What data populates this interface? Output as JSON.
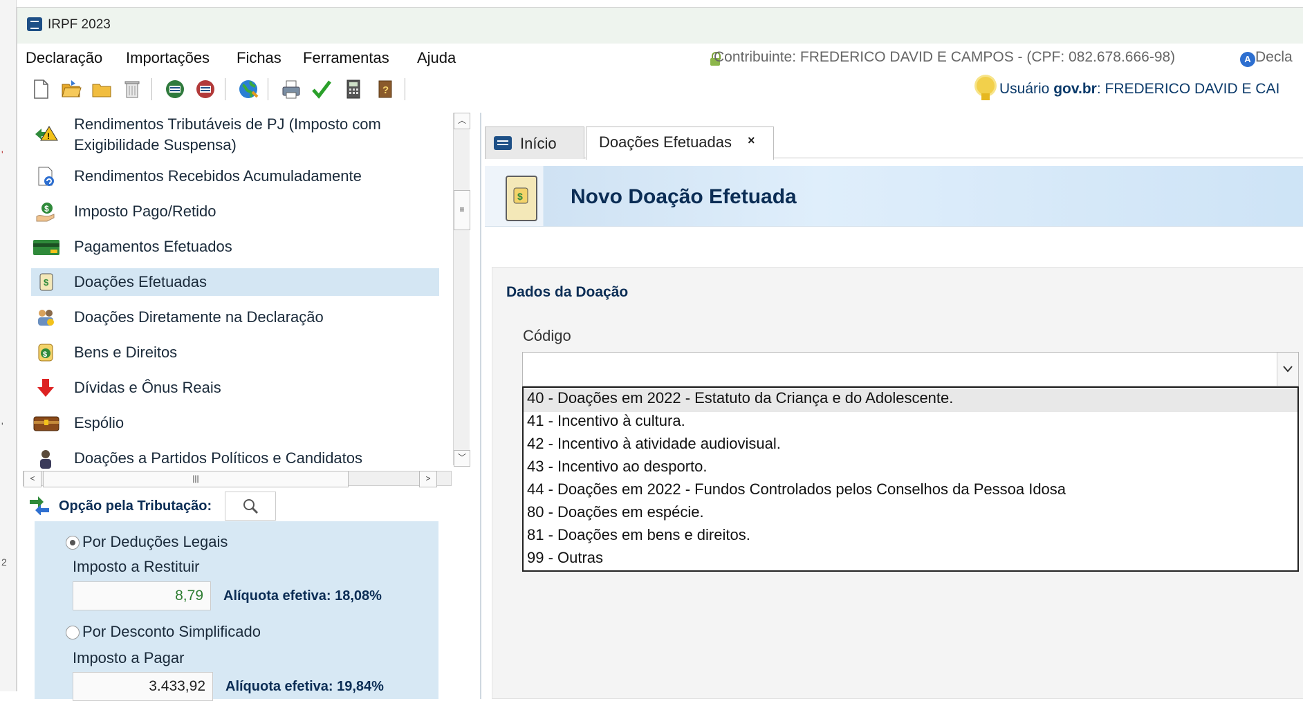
{
  "window": {
    "title": "IRPF 2023"
  },
  "menu": [
    "Declaração",
    "Importações",
    "Fichas",
    "Ferramentas",
    "Ajuda"
  ],
  "header": {
    "contribuinte": "Contribuinte: FREDERICO DAVID E CAMPOS - (CPF: 082.678.666-98)",
    "declaracao": "Decla",
    "usuario_prefix": "Usuário ",
    "usuario_bold": "gov.br",
    "usuario_suffix": ": FREDERICO DAVID E CAI"
  },
  "toolbar_icons": [
    "new-icon",
    "open-folder-icon",
    "folder-icon",
    "trash-icon",
    "receita-transmit-icon",
    "receita-receipt-icon",
    "globe-icon",
    "print-icon",
    "check-icon",
    "calculator-icon",
    "help-book-icon"
  ],
  "tree": {
    "items": [
      {
        "label": "Rendimentos Tributáveis de PJ (Imposto com",
        "label2": "Exigibilidade Suspensa)",
        "icon": "pj-suspensa-icon"
      },
      {
        "label": "Rendimentos Recebidos Acumuladamente",
        "icon": "rra-icon"
      },
      {
        "label": "Imposto Pago/Retido",
        "icon": "imposto-pago-icon"
      },
      {
        "label": "Pagamentos Efetuados",
        "icon": "pagamentos-icon"
      },
      {
        "label": "Doações Efetuadas",
        "icon": "doacoes-icon"
      },
      {
        "label": "Doações Diretamente na Declaração",
        "icon": "doacoes-diretas-icon"
      },
      {
        "label": "Bens e Direitos",
        "icon": "bens-icon"
      },
      {
        "label": "Dívidas e Ônus Reais",
        "icon": "dividas-icon"
      },
      {
        "label": "Espólio",
        "icon": "espolio-icon"
      },
      {
        "label": "Doações a Partidos Políticos e Candidatos",
        "icon": "partidos-icon"
      }
    ],
    "selected": "Doações Efetuadas"
  },
  "opcao": {
    "title": "Opção pela Tributação:",
    "deducoes_label": "Por Deduções Legais",
    "restituir_label": "Imposto a Restituir",
    "restituir_value": "8,79",
    "restituir_aliquota": "Alíquota efetiva: 18,08%",
    "simplificado_label": "Por Desconto Simplificado",
    "pagar_label": "Imposto a Pagar",
    "pagar_value": "3.433,92",
    "pagar_aliquota": "Alíquota efetiva: 19,84%",
    "selected": "Por Deduções Legais"
  },
  "tabs": [
    {
      "label": "Início"
    },
    {
      "label": "Doações Efetuadas",
      "close": "×"
    }
  ],
  "banner": {
    "title": "Novo Doação Efetuada"
  },
  "form": {
    "section": "Dados da Doação",
    "codigo_label": "Código",
    "codigo_value": "",
    "options": [
      "40 - Doações em 2022 - Estatuto da Criança e do Adolescente.",
      "41 - Incentivo à cultura.",
      "42 - Incentivo à atividade audiovisual.",
      "43 - Incentivo ao desporto.",
      "44 - Doações em 2022 - Fundos Controlados pelos Conselhos da Pessoa Idosa",
      "80 - Doações em espécie.",
      "81 - Doações em bens e direitos.",
      "99 - Outras"
    ]
  },
  "colors": {
    "accent": "#0b2d55",
    "selected_row": "#d4e6f3",
    "panel": "#d7e8f4",
    "value_green": "#2e7d32"
  }
}
